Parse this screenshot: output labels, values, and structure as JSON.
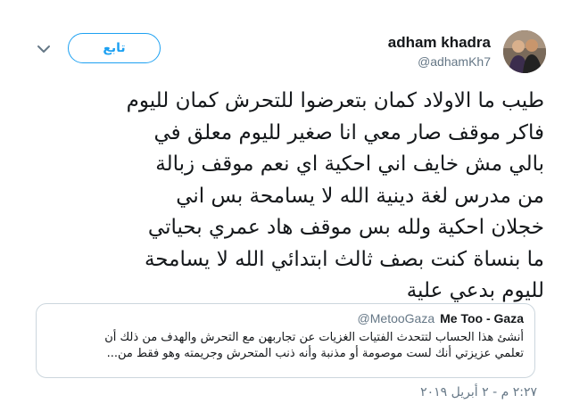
{
  "user": {
    "display_name": "adham khadra",
    "handle": "@adhamKh7"
  },
  "follow_label": "تابع",
  "tweet": {
    "lines": [
      "طيب ما الاولاد كمان بتعرضوا للتحرش كمان لليوم",
      "فاكر موقف صار معي انا صغير لليوم معلق في",
      "بالي مش خايف اني احكية اي نعم موقف زبالة",
      "من مدرس لغة دينية الله لا يسامحة بس اني",
      "خجلان احكية ولله بس موقف هاد عمري بحياتي",
      "ما بنساة كنت بصف ثالث ابتدائي الله لا يسامحة",
      "لليوم بدعي علية"
    ]
  },
  "quote": {
    "name": "Me Too - Gaza",
    "handle": "@MetooGaza",
    "lines": [
      "أنشئ هذا الحساب لتتحدث الفتيات الغزيات عن تجاربهن مع التحرش والهدف من ذلك أن",
      "تعلمي عزيزتي أنك لست موصومة أو مذنبة وأنه ذنب المتحرش وجريمته وهو فقط من..."
    ]
  },
  "timestamp": "٢:٢٧ م - ٢ أبريل ٢٠١٩",
  "icons": {
    "menu": "chevron-down-icon",
    "avatar": "avatar"
  },
  "colors": {
    "accent": "#1da1f2",
    "muted": "#657786",
    "border": "#ccd6dd",
    "text": "#14171a"
  }
}
